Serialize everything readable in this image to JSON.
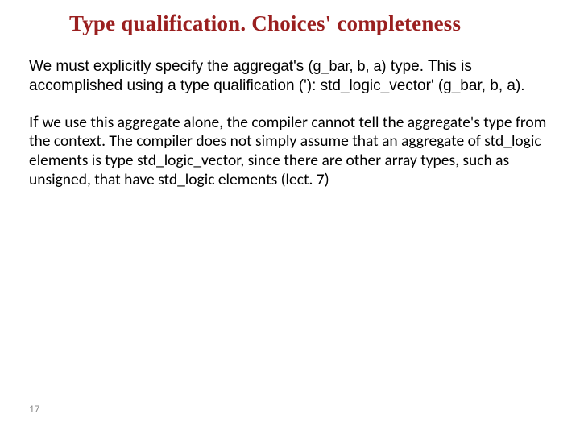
{
  "title": "Type qualification. Choices' completeness",
  "para1_a": "We must explicitly specify the aggregat's ",
  "para1_code1": "(g_bar, b, a)",
  "para1_b": " type. This is accomplished using a type qualification ('): std_logic_vector' (g_bar, b, a).",
  "para2_lead": "If ",
  "para2_body": "we use this aggregate alone, the compiler cannot tell the aggregate's type from the context. The compiler does not simply assume that an aggregate of std_logic elements is type std_logic_vector, since there are other array types, such as unsigned, that have std_logic elements (lect. 7)",
  "page_number": "17"
}
